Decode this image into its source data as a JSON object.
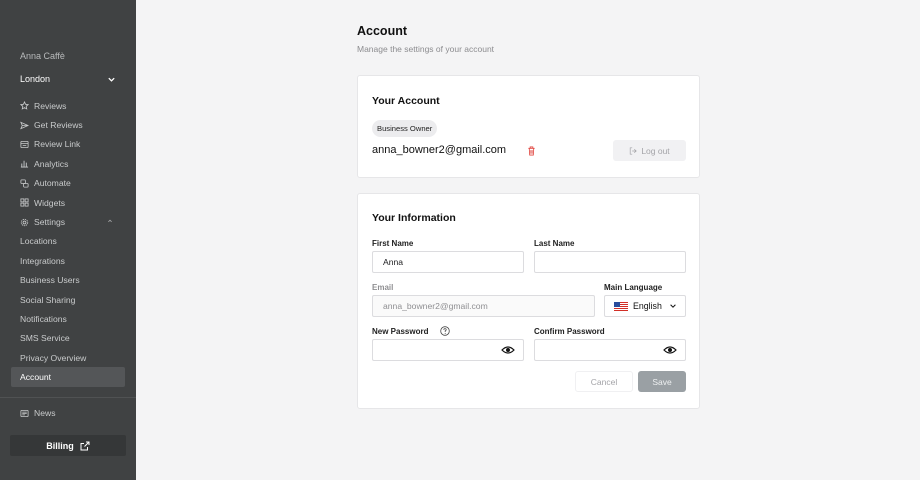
{
  "sidebar": {
    "brand": "Anna Caffè",
    "location": "London",
    "items": [
      {
        "label": "Reviews",
        "icon": "star-icon"
      },
      {
        "label": "Get Reviews",
        "icon": "send-icon"
      },
      {
        "label": "Review Link",
        "icon": "link-card-icon"
      },
      {
        "label": "Analytics",
        "icon": "bar-chart-icon"
      },
      {
        "label": "Automate",
        "icon": "automate-icon"
      },
      {
        "label": "Widgets",
        "icon": "widgets-icon"
      },
      {
        "label": "Settings",
        "icon": "gear-icon"
      }
    ],
    "settings_items": [
      {
        "label": "Locations"
      },
      {
        "label": "Integrations"
      },
      {
        "label": "Business Users"
      },
      {
        "label": "Social Sharing"
      },
      {
        "label": "Notifications"
      },
      {
        "label": "SMS Service"
      },
      {
        "label": "Privacy Overview"
      },
      {
        "label": "Account"
      }
    ],
    "news_label": "News",
    "billing_label": "Billing"
  },
  "page": {
    "title": "Account",
    "subtitle": "Manage the settings of your account"
  },
  "account_card": {
    "title": "Your Account",
    "role": "Business Owner",
    "email": "anna_bowner2@gmail.com",
    "logout_label": "Log out"
  },
  "info_card": {
    "title": "Your Information",
    "first_name_label": "First Name",
    "first_name_value": "Anna",
    "last_name_label": "Last Name",
    "last_name_value": "",
    "email_label": "Email",
    "email_value": "anna_bowner2@gmail.com",
    "language_label": "Main Language",
    "language_value": "English",
    "new_password_label": "New Password",
    "confirm_password_label": "Confirm Password",
    "cancel_label": "Cancel",
    "save_label": "Save"
  },
  "colors": {
    "sidebar_bg": "#404243",
    "active_item_bg": "#545658",
    "delete_red": "#e0443e",
    "save_btn": "#9aa0a4"
  }
}
